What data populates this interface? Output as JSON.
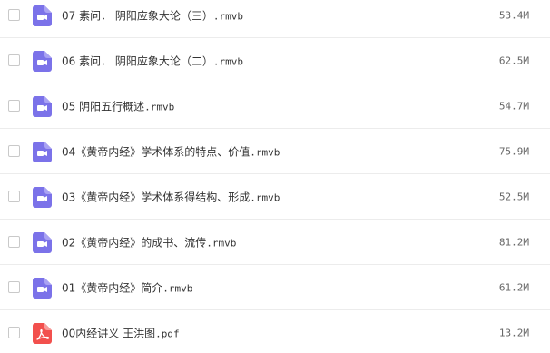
{
  "files": [
    {
      "name": "07 素问． 阴阳应象大论（三）",
      "ext": ".rmvb",
      "size": "53.4M",
      "icon": "video-file-icon",
      "icon_color": "#7b72e9"
    },
    {
      "name": "06 素问． 阴阳应象大论（二）",
      "ext": ".rmvb",
      "size": "62.5M",
      "icon": "video-file-icon",
      "icon_color": "#7b72e9"
    },
    {
      "name": "05 阴阳五行概述",
      "ext": ".rmvb",
      "size": "54.7M",
      "icon": "video-file-icon",
      "icon_color": "#7b72e9"
    },
    {
      "name": "04《黄帝内经》学术体系的特点、价值",
      "ext": ".rmvb",
      "size": "75.9M",
      "icon": "video-file-icon",
      "icon_color": "#7b72e9"
    },
    {
      "name": "03《黄帝内经》学术体系得结构、形成",
      "ext": ".rmvb",
      "size": "52.5M",
      "icon": "video-file-icon",
      "icon_color": "#7b72e9"
    },
    {
      "name": "02《黄帝内经》的成书、流传",
      "ext": ".rmvb",
      "size": "81.2M",
      "icon": "video-file-icon",
      "icon_color": "#7b72e9"
    },
    {
      "name": "01《黄帝内经》简介",
      "ext": ".rmvb",
      "size": "61.2M",
      "icon": "video-file-icon",
      "icon_color": "#7b72e9"
    },
    {
      "name": "00内经讲义 王洪图",
      "ext": ".pdf",
      "size": "13.2M",
      "icon": "pdf-file-icon",
      "icon_color": "#f2504d"
    }
  ]
}
